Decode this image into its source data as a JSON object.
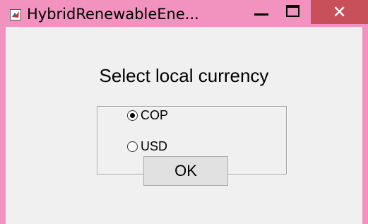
{
  "window": {
    "title": "HybridRenewableEne...",
    "minimize_icon": "minimize-icon",
    "maximize_icon": "maximize-icon",
    "close_glyph": "✕",
    "titlebar_color": "#f193be",
    "close_color": "#c7505a"
  },
  "dialog": {
    "heading": "Select local currency",
    "options": [
      {
        "label": "COP",
        "selected": true
      },
      {
        "label": "USD",
        "selected": false
      }
    ],
    "ok_label": "OK"
  }
}
